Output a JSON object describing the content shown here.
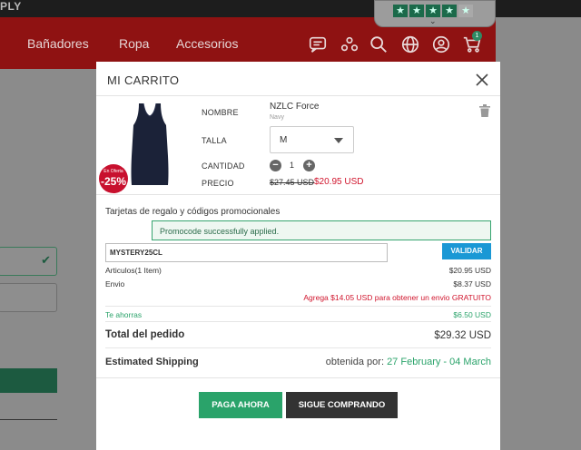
{
  "header": {
    "logo_fragment": "PLY",
    "nav": [
      "Bañadores",
      "Ropa",
      "Accesorios"
    ],
    "cart_count": "1",
    "icons": [
      "chat-icon",
      "community-icon",
      "search-icon",
      "globe-icon",
      "account-icon",
      "cart-icon"
    ]
  },
  "trustpilot": {
    "stars": 4,
    "max": 5
  },
  "colors": {
    "accent_green": "#2aa36a",
    "sale_red": "#d0142c",
    "validar_blue": "#1a98d5",
    "nav_red": "#c8102e"
  },
  "cart": {
    "title": "MI CARRITO",
    "labels": {
      "name": "NOMBRE",
      "size": "TALLA",
      "quantity": "CANTIDAD",
      "price": "PRECIO"
    },
    "product": {
      "name": "NZLC Force",
      "color": "Navy",
      "size": "M",
      "quantity": "1",
      "old_price": "$27.45 USD",
      "new_price": "$20.95 USD",
      "badge_top": "En Oferta",
      "badge_discount": "-25%"
    },
    "promo": {
      "title": "Tarjetas de regalo y códigos promocionales",
      "success_msg": "Promocode successfully applied.",
      "code": "MYSTERY25CL",
      "validate_label": "VALIDAR"
    },
    "summary": {
      "items_label": "Articulos(1 Item)",
      "items_value": "$20.95 USD",
      "shipping_label": "Envio",
      "shipping_value": "$8.37 USD",
      "free_shipping_msg": "Agrega $14.05 USD para obtener un envio GRATUITO",
      "savings_label": "Te ahorras",
      "savings_value": "$6.50 USD",
      "total_label": "Total del pedido",
      "total_value": "$29.32 USD",
      "est_shipping_label": "Estimated Shipping",
      "est_shipping_prefix": "obtenida por:",
      "est_shipping_dates": "27 February - 04 March"
    },
    "buttons": {
      "pay": "PAGA AHORA",
      "continue": "SIGUE COMPRANDO"
    }
  }
}
